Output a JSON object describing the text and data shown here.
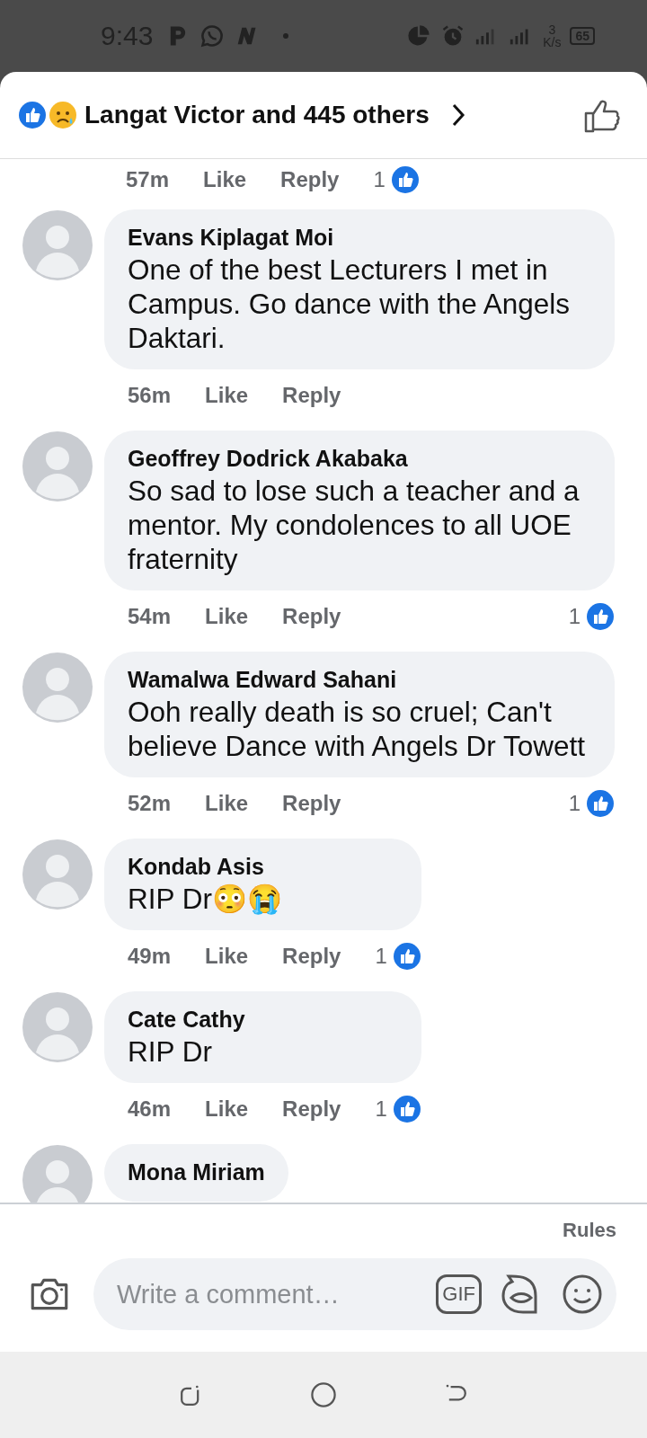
{
  "status_bar": {
    "time": "9:43",
    "speed_value": "3",
    "speed_unit": "K/s",
    "battery": "65"
  },
  "header": {
    "reactors": "Langat Victor and 445 others"
  },
  "previous_comment_meta": {
    "time": "57m",
    "like": "Like",
    "reply": "Reply",
    "reaction_count": "1"
  },
  "comments": [
    {
      "author": "Evans Kiplagat Moi",
      "text": "One of the best Lecturers I met in Campus. Go dance with the Angels Daktari.",
      "time": "56m",
      "like": "Like",
      "reply": "Reply"
    },
    {
      "author": "Geoffrey Dodrick Akabaka",
      "text": "So sad to lose such a teacher and a mentor. My condolences to all UOE fraternity",
      "time": "54m",
      "like": "Like",
      "reply": "Reply",
      "reaction_count": "1"
    },
    {
      "author": "Wamalwa Edward Sahani",
      "text": "Ooh really death is so cruel; Can't believe Dance with Angels Dr Towett",
      "time": "52m",
      "like": "Like",
      "reply": "Reply",
      "reaction_count": "1"
    },
    {
      "author": "Kondab Asis",
      "text": "RIP Dr😳😭",
      "time": "49m",
      "like": "Like",
      "reply": "Reply",
      "reaction_count": "1"
    },
    {
      "author": "Cate Cathy",
      "text": "RIP Dr",
      "time": "46m",
      "like": "Like",
      "reply": "Reply",
      "reaction_count": "1"
    },
    {
      "author": "Mona Miriam"
    }
  ],
  "rules_link": "Rules",
  "comment_field": {
    "placeholder": "Write a comment…"
  },
  "gif_button": "GIF"
}
